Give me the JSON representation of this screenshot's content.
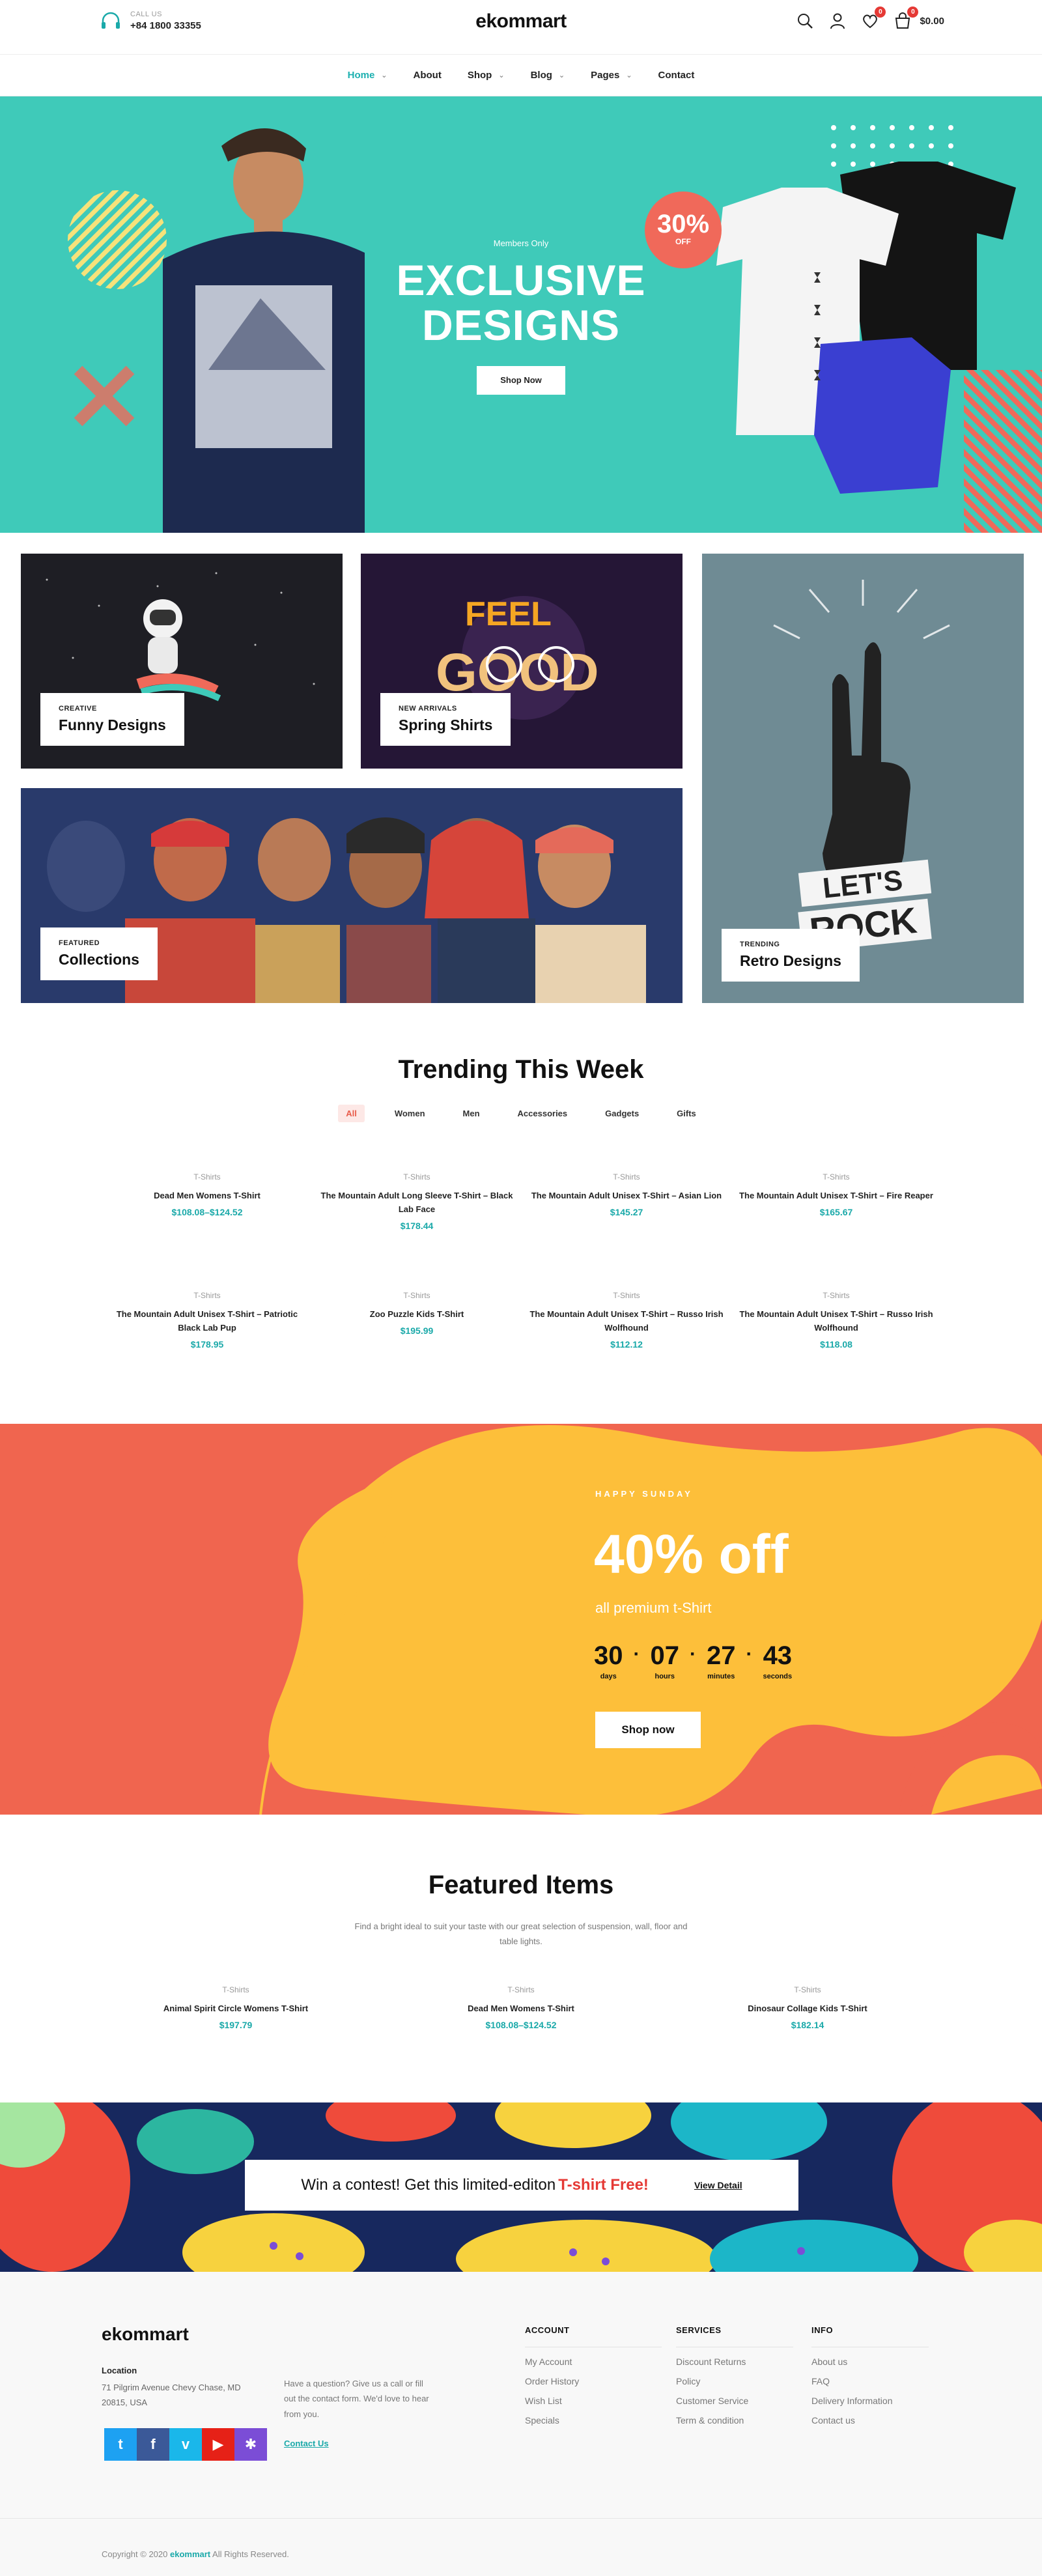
{
  "header": {
    "call_label": "CALL US",
    "phone": "+84 1800 33355",
    "logo": "ekommart",
    "wishlist_count": "0",
    "cart_count": "0",
    "cart_total": "$0.00"
  },
  "nav": {
    "items": [
      {
        "label": "Home",
        "dropdown": true
      },
      {
        "label": "About",
        "dropdown": false
      },
      {
        "label": "Shop",
        "dropdown": true
      },
      {
        "label": "Blog",
        "dropdown": true
      },
      {
        "label": "Pages",
        "dropdown": true
      },
      {
        "label": "Contact",
        "dropdown": false
      }
    ]
  },
  "hero": {
    "eyebrow": "Members Only",
    "title_line1": "EXCLUSIVE",
    "title_line2": "DESIGNS",
    "button": "Shop Now",
    "badge_pct": "30%",
    "badge_off": "OFF",
    "bg": "#3fcab9",
    "accent": "#f0695a"
  },
  "categories": [
    {
      "small": "CREATIVE",
      "title": "Funny Designs"
    },
    {
      "small": "NEW ARRIVALS",
      "title": "Spring Shirts"
    },
    {
      "small": "TRENDING",
      "title": "Retro Designs"
    },
    {
      "small": "FEATURED",
      "title": "Collections"
    }
  ],
  "trending": {
    "title": "Trending This Week",
    "tabs": [
      "All",
      "Women",
      "Men",
      "Accessories",
      "Gadgets",
      "Gifts"
    ],
    "products": [
      {
        "cat": "T-Shirts",
        "name": "Dead Men Womens T-Shirt",
        "price": "$108.08–$124.52"
      },
      {
        "cat": "T-Shirts",
        "name": "The Mountain Adult Long Sleeve T-Shirt – Black Lab Face",
        "price": "$178.44"
      },
      {
        "cat": "T-Shirts",
        "name": "The Mountain Adult Unisex T-Shirt – Asian Lion",
        "price": "$145.27"
      },
      {
        "cat": "T-Shirts",
        "name": "The Mountain Adult Unisex T-Shirt – Fire Reaper",
        "price": "$165.67"
      },
      {
        "cat": "T-Shirts",
        "name": "The Mountain Adult Unisex T-Shirt – Patriotic Black Lab Pup",
        "price": "$178.95"
      },
      {
        "cat": "T-Shirts",
        "name": "Zoo Puzzle Kids T-Shirt",
        "price": "$195.99"
      },
      {
        "cat": "T-Shirts",
        "name": "The Mountain Adult Unisex T-Shirt – Russo Irish Wolfhound",
        "price": "$112.12"
      },
      {
        "cat": "T-Shirts",
        "name": "The Mountain Adult Unisex T-Shirt – Russo Irish Wolfhound",
        "price": "$118.08"
      }
    ]
  },
  "sale": {
    "eyebrow": "HAPPY SUNDAY",
    "title": "40% off",
    "subtitle": "all premium t-Shirt",
    "countdown": [
      {
        "value": "30",
        "label": "days"
      },
      {
        "value": "07",
        "label": "hours"
      },
      {
        "value": "27",
        "label": "minutes"
      },
      {
        "value": "43",
        "label": "seconds"
      }
    ],
    "button": "Shop now"
  },
  "featured": {
    "title": "Featured Items",
    "subtitle": "Find a bright ideal to suit your taste with our great selection of suspension, wall, floor and table lights.",
    "products": [
      {
        "cat": "T-Shirts",
        "name": "Animal Spirit Circle Womens T-Shirt",
        "price": "$197.79"
      },
      {
        "cat": "T-Shirts",
        "name": "Dead Men Womens T-Shirt",
        "price": "$108.08–$124.52"
      },
      {
        "cat": "T-Shirts",
        "name": "Dinosaur Collage Kids T-Shirt",
        "price": "$182.14"
      }
    ]
  },
  "contest": {
    "text": "Win a contest! Get this limited-editon",
    "highlight": "T-shirt Free!",
    "link": "View Detail"
  },
  "footer": {
    "logo": "ekommart",
    "location_heading": "Location",
    "address": "71 Pilgrim Avenue Chevy Chase, MD 20815, USA",
    "question": "Have a question? Give us a call or fill out the contact form. We'd love to hear from you.",
    "contact_link": "Contact Us",
    "columns": [
      {
        "heading": "ACCOUNT",
        "links": [
          "My Account",
          "Order History",
          "Wish List",
          "Specials"
        ]
      },
      {
        "heading": "SERVICES",
        "links": [
          "Discount Returns",
          "Policy",
          "Customer Service",
          "Term & condition"
        ]
      },
      {
        "heading": "INFO",
        "links": [
          "About us",
          "FAQ",
          "Delivery Information",
          "Contact us"
        ]
      }
    ],
    "social": [
      {
        "icon": "twitter-icon",
        "glyph": "t",
        "color": "#1da1f2"
      },
      {
        "icon": "facebook-icon",
        "glyph": "f",
        "color": "#3b5998"
      },
      {
        "icon": "vimeo-icon",
        "glyph": "v",
        "color": "#1ab7ea"
      },
      {
        "icon": "youtube-icon",
        "glyph": "▶",
        "color": "#e62117"
      },
      {
        "icon": "yelp-icon",
        "glyph": "✱",
        "color": "#7b4dd6"
      }
    ],
    "copyright_prefix": "Copyright © 2020",
    "copyright_brand": "ekommart",
    "copyright_suffix": "All Rights Reserved."
  }
}
